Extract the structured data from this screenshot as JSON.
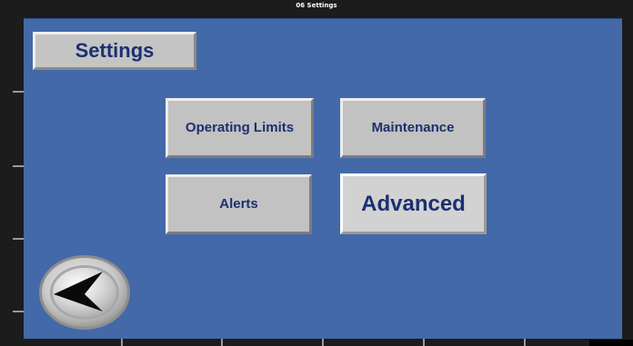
{
  "window": {
    "title": "06 Settings"
  },
  "screen": {
    "title": "Settings"
  },
  "buttons": {
    "operating_limits": "Operating Limits",
    "maintenance": "Maintenance",
    "alerts": "Alerts",
    "advanced": "Advanced"
  },
  "icons": {
    "back": "arrow-left-icon"
  },
  "colors": {
    "screen_background": "#4369a9",
    "button_face": "#c2c2c2",
    "label_text": "#1c2f70",
    "frame": "#1c1c1c"
  }
}
